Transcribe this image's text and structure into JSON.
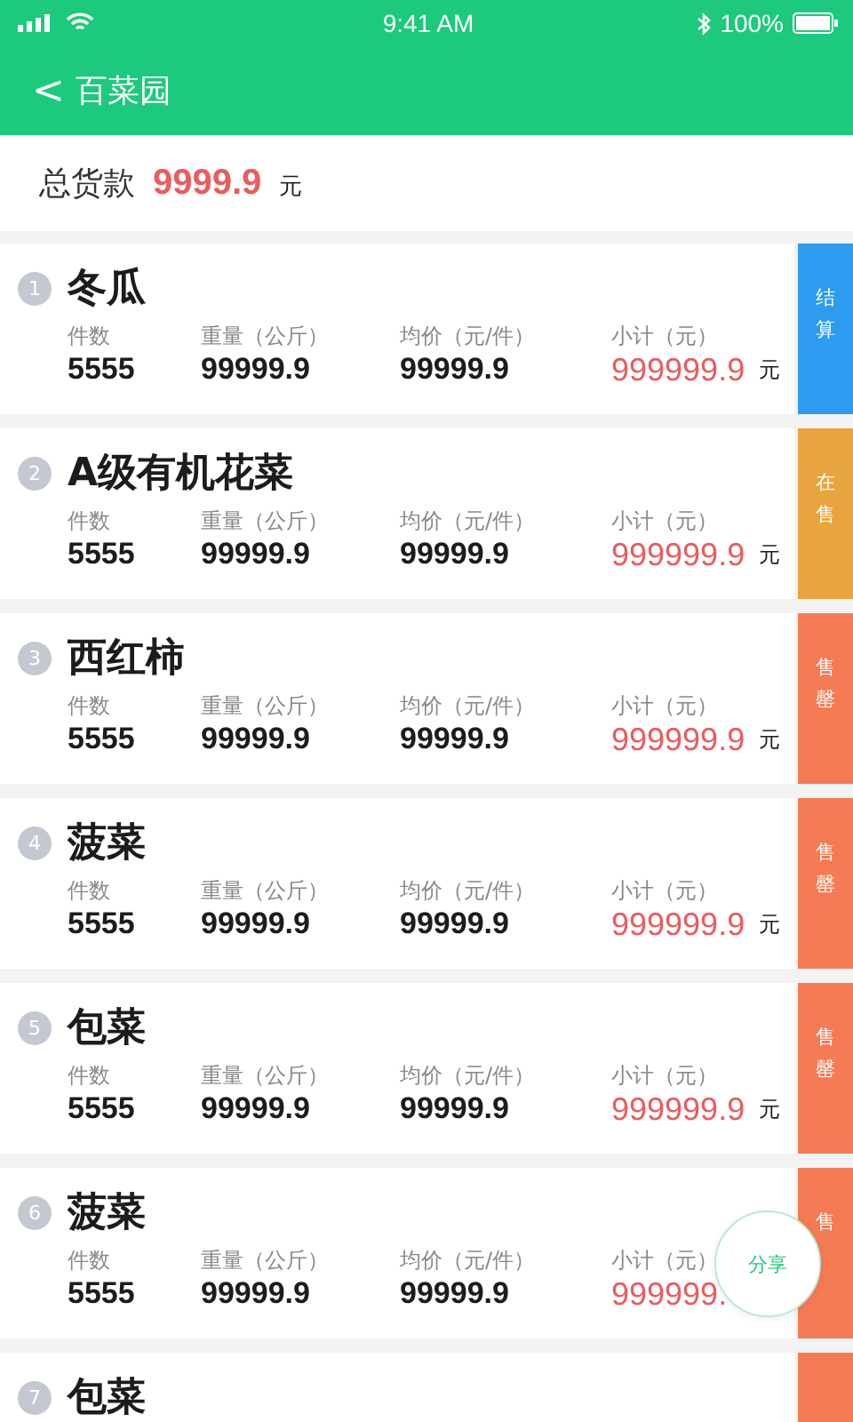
{
  "status_bar": {
    "time": "9:41 AM",
    "battery": "100%"
  },
  "nav": {
    "back": "<",
    "title": "百菜园"
  },
  "total": {
    "label": "总货款",
    "amount": "9999.9",
    "unit": "元"
  },
  "rows": [
    {
      "index": "1",
      "name": "冬瓜",
      "labels": [
        "件数",
        "重量（公斤）",
        "均价（元/件）",
        "小计（元）"
      ],
      "count": "5555",
      "weight": "99999.9",
      "price": "99999.9",
      "subtotal": "999999.9",
      "unit": "元",
      "action": {
        "label": "结算",
        "color": "#2d9bf0"
      }
    },
    {
      "index": "2",
      "name": "A级有机花菜",
      "labels": [
        "件数",
        "重量（公斤）",
        "均价（元/件）",
        "小计（元）"
      ],
      "count": "5555",
      "weight": "99999.9",
      "price": "99999.9",
      "subtotal": "999999.9",
      "unit": "元",
      "action": {
        "label": "在售",
        "color": "#e8a43e"
      }
    },
    {
      "index": "3",
      "name": "西红柿",
      "labels": [
        "件数",
        "重量（公斤）",
        "均价（元/件）",
        "小计（元）"
      ],
      "count": "5555",
      "weight": "99999.9",
      "price": "99999.9",
      "subtotal": "999999.9",
      "unit": "元",
      "action": {
        "label": "售罄",
        "color": "#f57b55"
      }
    },
    {
      "index": "4",
      "name": "菠菜",
      "labels": [
        "件数",
        "重量（公斤）",
        "均价（元/件）",
        "小计（元）"
      ],
      "count": "5555",
      "weight": "99999.9",
      "price": "99999.9",
      "subtotal": "999999.9",
      "unit": "元",
      "action": {
        "label": "售罄",
        "color": "#f57b55"
      }
    },
    {
      "index": "5",
      "name": "包菜",
      "labels": [
        "件数",
        "重量（公斤）",
        "均价（元/件）",
        "小计（元）"
      ],
      "count": "5555",
      "weight": "99999.9",
      "price": "99999.9",
      "subtotal": "999999.9",
      "unit": "元",
      "action": {
        "label": "售罄",
        "color": "#f57b55"
      }
    },
    {
      "index": "6",
      "name": "菠菜",
      "labels": [
        "件数",
        "重量（公斤）",
        "均价（元/件）",
        "小计（元）"
      ],
      "count": "5555",
      "weight": "99999.9",
      "price": "99999.9",
      "subtotal": "999999.",
      "action": {
        "label": "售",
        "color": "#f57b55"
      }
    },
    {
      "index": "7",
      "name": "包菜",
      "action": {
        "color": "#f57b55"
      }
    }
  ],
  "share_button": "分享"
}
